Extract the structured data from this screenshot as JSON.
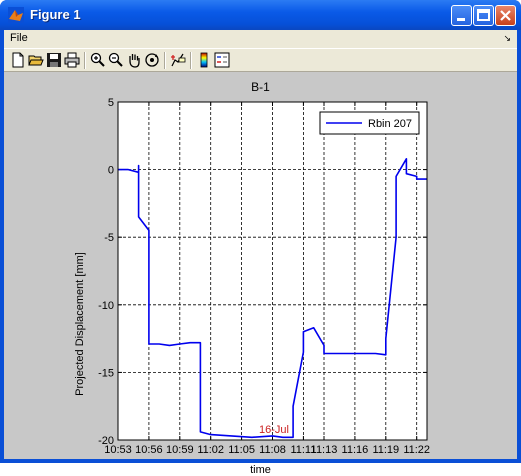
{
  "window": {
    "title": "Figure 1"
  },
  "menubar": {
    "file_label": "File",
    "dock_arrow": "↘"
  },
  "toolbar": {
    "tools": [
      "new-file-icon",
      "open-folder-icon",
      "save-icon",
      "print-icon",
      "zoom-in-icon",
      "zoom-out-icon",
      "pan-hand-icon",
      "rotate-3d-icon",
      "data-cursor-icon",
      "colorbar-icon",
      "legend-icon"
    ]
  },
  "chart_data": {
    "type": "line",
    "title": "B-1",
    "xlabel": "time",
    "ylabel": "Projected Displacement [mm]",
    "ylim": [
      -20,
      5
    ],
    "yticks": [
      "5",
      "0",
      "-5",
      "-10",
      "-15",
      "-20"
    ],
    "xticks": [
      "10:53",
      "10:56",
      "10:59",
      "11:02",
      "11:05",
      "11:08",
      "11:11",
      "11:13",
      "11:16",
      "11:19",
      "11:22"
    ],
    "grid": true,
    "legend_position": "top-right",
    "annotation": {
      "text": "16-Jul",
      "color": "#cc2222"
    },
    "series": [
      {
        "name": "Rbin  207",
        "color": "#0000ee",
        "points": [
          [
            "10:53",
            0.0
          ],
          [
            "10:54",
            0.0
          ],
          [
            "10:55",
            -0.2
          ],
          [
            "10:55",
            0.3
          ],
          [
            "10:55",
            -0.3
          ],
          [
            "10:55",
            -3.5
          ],
          [
            "10:56",
            -4.5
          ],
          [
            "10:56",
            -7.0
          ],
          [
            "10:56",
            -12.9
          ],
          [
            "10:57",
            -12.9
          ],
          [
            "10:58",
            -13.0
          ],
          [
            "10:59",
            -12.9
          ],
          [
            "11:00",
            -12.8
          ],
          [
            "11:00",
            -12.8
          ],
          [
            "11:01",
            -12.8
          ],
          [
            "11:01",
            -19.4
          ],
          [
            "11:02",
            -19.6
          ],
          [
            "11:04",
            -19.7
          ],
          [
            "11:06",
            -19.8
          ],
          [
            "11:08",
            -19.7
          ],
          [
            "11:09",
            -19.8
          ],
          [
            "11:10",
            -19.8
          ],
          [
            "11:10",
            -17.5
          ],
          [
            "11:11",
            -13.5
          ],
          [
            "11:11",
            -12.0
          ],
          [
            "11:12",
            -11.7
          ],
          [
            "11:13",
            -13.0
          ],
          [
            "11:13",
            -13.6
          ],
          [
            "11:14",
            -13.6
          ],
          [
            "11:16",
            -13.6
          ],
          [
            "11:18",
            -13.6
          ],
          [
            "11:19",
            -13.7
          ],
          [
            "11:19",
            -12.5
          ],
          [
            "11:20",
            -5.0
          ],
          [
            "11:20",
            -0.5
          ],
          [
            "11:21",
            0.8
          ],
          [
            "11:21",
            -0.3
          ],
          [
            "11:22",
            -0.5
          ],
          [
            "11:22",
            -0.7
          ],
          [
            "11:23",
            -0.7
          ]
        ]
      }
    ]
  }
}
